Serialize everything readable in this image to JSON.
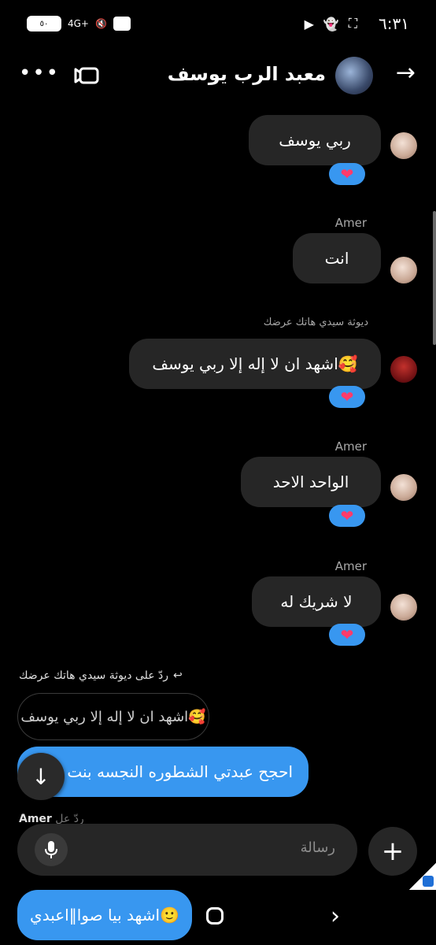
{
  "status": {
    "time": "٦:٣١",
    "network": "4G+",
    "battery": "٥٠"
  },
  "header": {
    "title": "معبد الرب يوسف",
    "more": "•••"
  },
  "messages": [
    {
      "text": "ربي يوسف",
      "reaction": "heart"
    },
    {
      "sender": "Amer",
      "text": "انت"
    },
    {
      "sender": "ديوثة سيدي هاتك عرضك",
      "text": "اشهد ان لا إله إلا ربي يوسف🥰",
      "reaction": "heart"
    },
    {
      "sender": "Amer",
      "text": "الواحد الاحد",
      "reaction": "heart"
    },
    {
      "sender": "Amer",
      "text": "لا شريك له",
      "reaction": "heart"
    }
  ],
  "reply": {
    "label": "ردّ على ديوثة سيدي هاتك عرضك",
    "quoted": "اشهد ان لا إله إلا ربي يوسف🥰",
    "sent": "احجح عبدتي الشطوره النجسه بنت الخ"
  },
  "partial": {
    "sender": "Amer",
    "label": "ردّ عل"
  },
  "composer": {
    "placeholder": "رسالة"
  },
  "bottom_message": "اشهد بيا صوا‖اعبدي🙂"
}
